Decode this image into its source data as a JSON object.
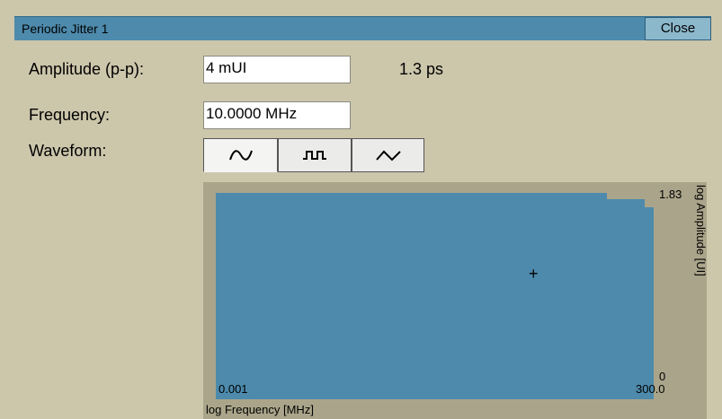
{
  "window": {
    "title": "Periodic Jitter 1",
    "close_label": "Close"
  },
  "fields": {
    "amplitude_label": "Amplitude (p-p):",
    "amplitude_value": "4 mUI",
    "amplitude_readout": "1.3 ps",
    "frequency_label": "Frequency:",
    "frequency_value": "10.0000 MHz",
    "waveform_label": "Waveform:"
  },
  "waveforms": [
    {
      "name": "sine",
      "icon": "sine-wave-icon",
      "selected": true
    },
    {
      "name": "square",
      "icon": "square-wave-icon",
      "selected": false
    },
    {
      "name": "triangle",
      "icon": "triangle-wave-icon",
      "selected": false
    }
  ],
  "plot": {
    "x_min_label": "0.001",
    "x_max_label": "300.0",
    "y_max_label": "1.83",
    "y_min_label": "0",
    "x_axis_label": "log Frequency [MHz]",
    "y_axis_label": "log Amplitude [UI]",
    "cursor_symbol": "+",
    "fill_color": "#4d8aac",
    "frame_color": "#aaa58a"
  }
}
